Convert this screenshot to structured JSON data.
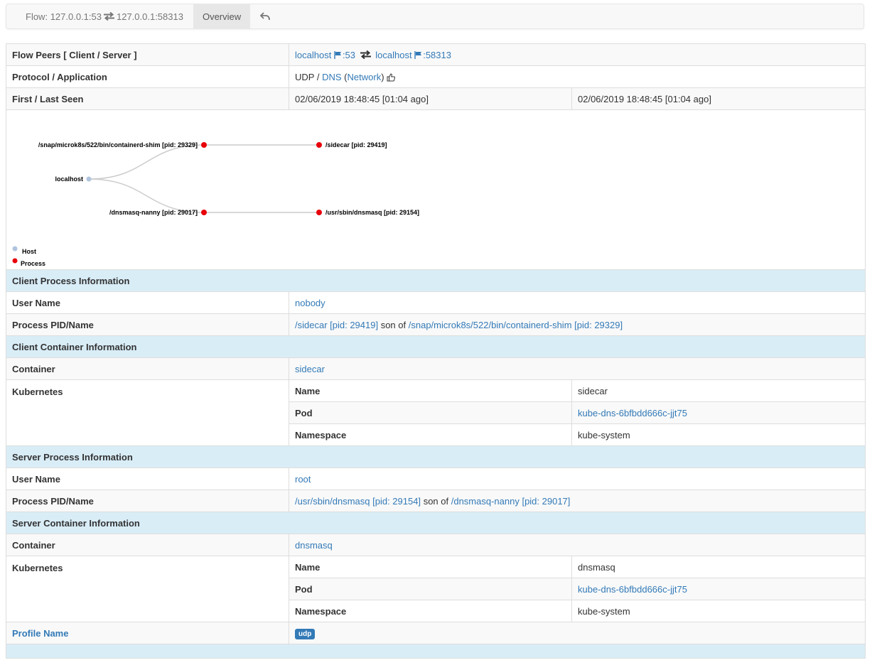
{
  "navbar": {
    "flow_label": "Flow:",
    "client": "127.0.0.1:53",
    "server": "127.0.0.1:58313",
    "tab_overview": "Overview"
  },
  "flow_peers": {
    "label": "Flow Peers [ Client / Server ]",
    "client_host": "localhost",
    "client_port": ":53",
    "server_host": "localhost",
    "server_port": ":58313"
  },
  "protocol": {
    "label": "Protocol / Application",
    "l4": "UDP",
    "sep": "/",
    "app": "DNS",
    "category": "Network",
    "paren_open": "(",
    "paren_close": ")"
  },
  "seen": {
    "label": "First / Last Seen",
    "first": "02/06/2019 18:48:45 [01:04 ago]",
    "last": "02/06/2019 18:48:45 [01:04 ago]"
  },
  "graph": {
    "nodes": {
      "host": "localhost",
      "client_parent": "/snap/microk8s/522/bin/containerd-shim [pid: 29329]",
      "client_proc": "/sidecar [pid: 29419]",
      "server_parent": "/dnsmasq-nanny [pid: 29017]",
      "server_proc": "/usr/sbin/dnsmasq [pid: 29154]"
    },
    "legend": {
      "host": "Host",
      "process": "Process"
    },
    "colors": {
      "host": "#b0c4de",
      "process": "#e8000b",
      "link": "#cccccc"
    }
  },
  "client_process": {
    "section": "Client Process Information",
    "user_label": "User Name",
    "user": "nobody",
    "pid_label": "Process PID/Name",
    "proc": "/sidecar [pid: 29419]",
    "son_of": "son of",
    "parent": "/snap/microk8s/522/bin/containerd-shim [pid: 29329]"
  },
  "client_container": {
    "section": "Client Container Information",
    "container_label": "Container",
    "container": "sidecar",
    "kube_label": "Kubernetes",
    "name_label": "Name",
    "name": "sidecar",
    "pod_label": "Pod",
    "pod": "kube-dns-6bfbdd666c-jjt75",
    "ns_label": "Namespace",
    "ns": "kube-system"
  },
  "server_process": {
    "section": "Server Process Information",
    "user_label": "User Name",
    "user": "root",
    "pid_label": "Process PID/Name",
    "proc": "/usr/sbin/dnsmasq [pid: 29154]",
    "son_of": "son of",
    "parent": "/dnsmasq-nanny [pid: 29017]"
  },
  "server_container": {
    "section": "Server Container Information",
    "container_label": "Container",
    "container": "dnsmasq",
    "kube_label": "Kubernetes",
    "name_label": "Name",
    "name": "dnsmasq",
    "pod_label": "Pod",
    "pod": "kube-dns-6bfbdd666c-jjt75",
    "ns_label": "Namespace",
    "ns": "kube-system"
  },
  "profile": {
    "label": "Profile Name",
    "badge": "udp"
  }
}
